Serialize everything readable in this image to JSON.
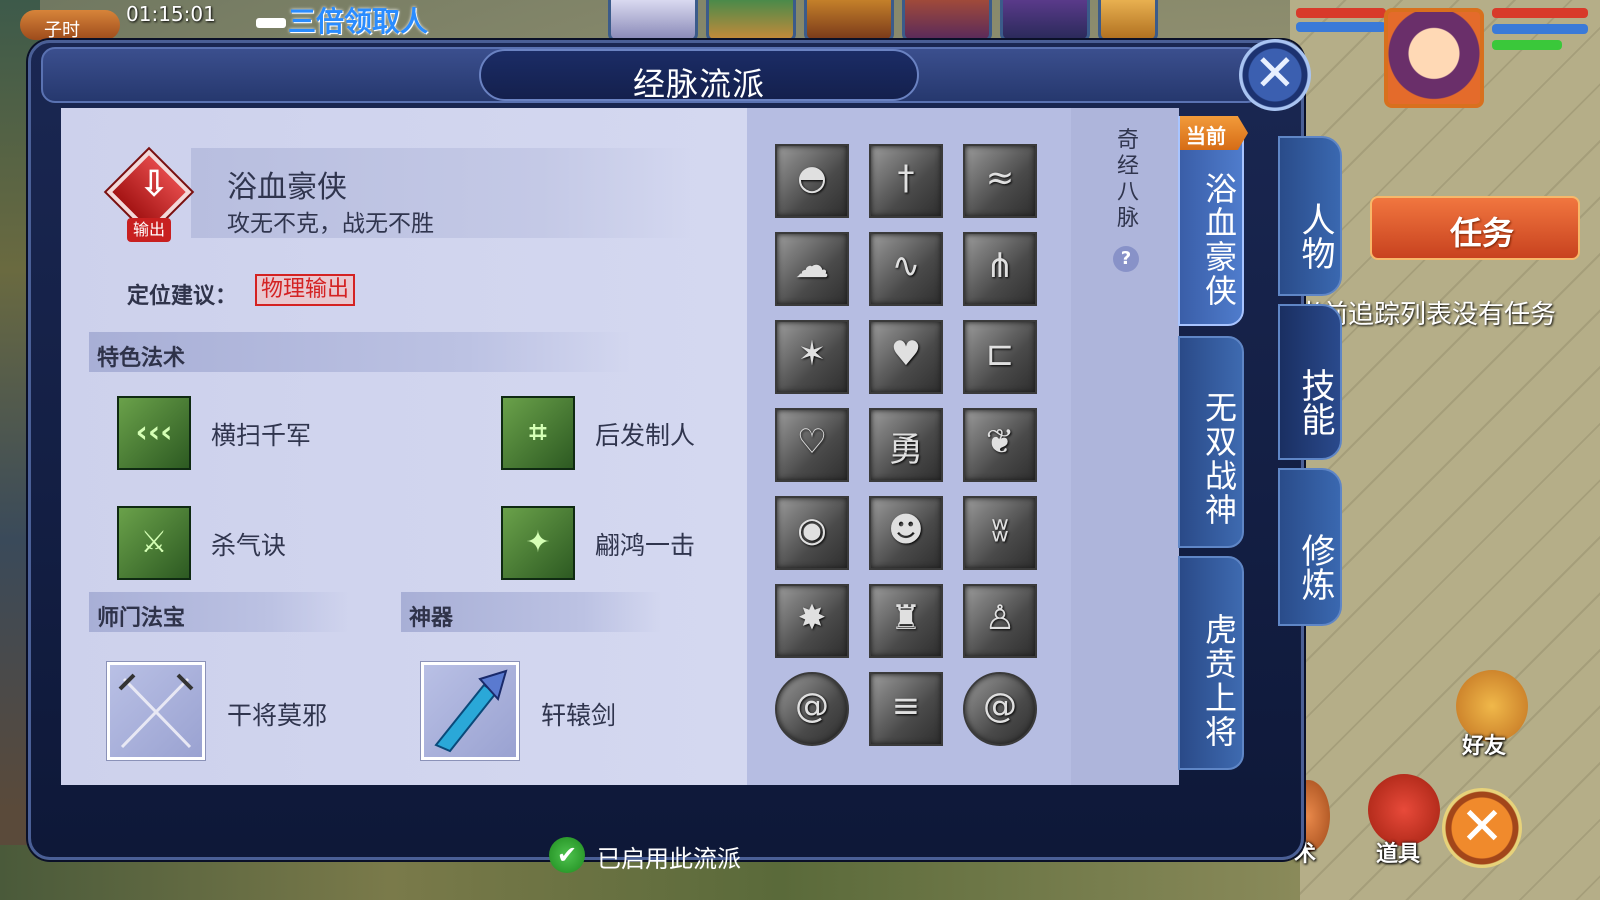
{
  "hud": {
    "time_tag": "子时",
    "time": "01:15:01",
    "promo": "三倍领取人",
    "task_tab": "任务",
    "task_empty": "当前追踪列表没有任务",
    "friends": "好友",
    "items": "道具",
    "skill_short": "术",
    "close_icon": "close-icon"
  },
  "dialog": {
    "title": "经脉流派",
    "close_glyph": "✕",
    "school": {
      "name": "浴血豪侠",
      "motto": "攻无不克，战无不胜",
      "role_tag": "输出",
      "position_label": "定位建议：",
      "position_value": "物理输出"
    },
    "sections": {
      "special_spells": "特色法术",
      "sect_treasure": "师门法宝",
      "artifact": "神器"
    },
    "spells": [
      {
        "label": "横扫千军",
        "icon": "triple-chevron-icon",
        "glyph": "‹‹‹"
      },
      {
        "label": "后发制人",
        "icon": "frame-strike-icon",
        "glyph": "⌗"
      },
      {
        "label": "杀气诀",
        "icon": "killing-aura-icon",
        "glyph": "⚔"
      },
      {
        "label": "翩鸿一击",
        "icon": "swan-strike-icon",
        "glyph": "✦"
      }
    ],
    "treasure": {
      "label": "干将莫邪",
      "icon": "crossed-swords-icon"
    },
    "artifact_item": {
      "label": "轩辕剑",
      "icon": "xuanyuan-sword-icon"
    },
    "meridian_title": "奇经八脉",
    "help": "?",
    "meridian_nodes": [
      {
        "icon": "eye-blade-icon",
        "glyph": "◓"
      },
      {
        "icon": "sword-in-ground-icon",
        "glyph": "†"
      },
      {
        "icon": "roar-icon",
        "glyph": "≈"
      },
      {
        "icon": "storm-cloud-icon",
        "glyph": "☁"
      },
      {
        "icon": "wave-icon",
        "glyph": "∿"
      },
      {
        "icon": "thorns-icon",
        "glyph": "⋔"
      },
      {
        "icon": "burst-icon",
        "glyph": "✶"
      },
      {
        "icon": "heart-hands-icon",
        "glyph": "♥"
      },
      {
        "icon": "gate-icon",
        "glyph": "⊏"
      },
      {
        "icon": "heart-beetle-icon",
        "glyph": "♡"
      },
      {
        "icon": "courage-icon",
        "glyph": "勇"
      },
      {
        "icon": "blade-leaf-icon",
        "glyph": "❦"
      },
      {
        "icon": "spiral-flame-icon",
        "glyph": "◉"
      },
      {
        "icon": "thinker-icon",
        "glyph": "☻"
      },
      {
        "icon": "praying-hands-icon",
        "glyph": "ʬ"
      },
      {
        "icon": "flex-icon",
        "glyph": "✸"
      },
      {
        "icon": "warrior-icon",
        "glyph": "♜"
      },
      {
        "icon": "figure-icon",
        "glyph": "♙"
      },
      {
        "icon": "swirl-left-icon",
        "glyph": "@"
      },
      {
        "icon": "arrows-icon",
        "glyph": "≡"
      },
      {
        "icon": "swirl-right-icon",
        "glyph": "@"
      }
    ],
    "current_ribbon": "当前",
    "school_tabs": [
      "浴血豪侠",
      "无双战神",
      "虎贲上将"
    ],
    "outer_tabs": [
      "人物",
      "技能",
      "修炼"
    ],
    "footer": {
      "check": "✔",
      "text": "已启用此流派"
    }
  }
}
